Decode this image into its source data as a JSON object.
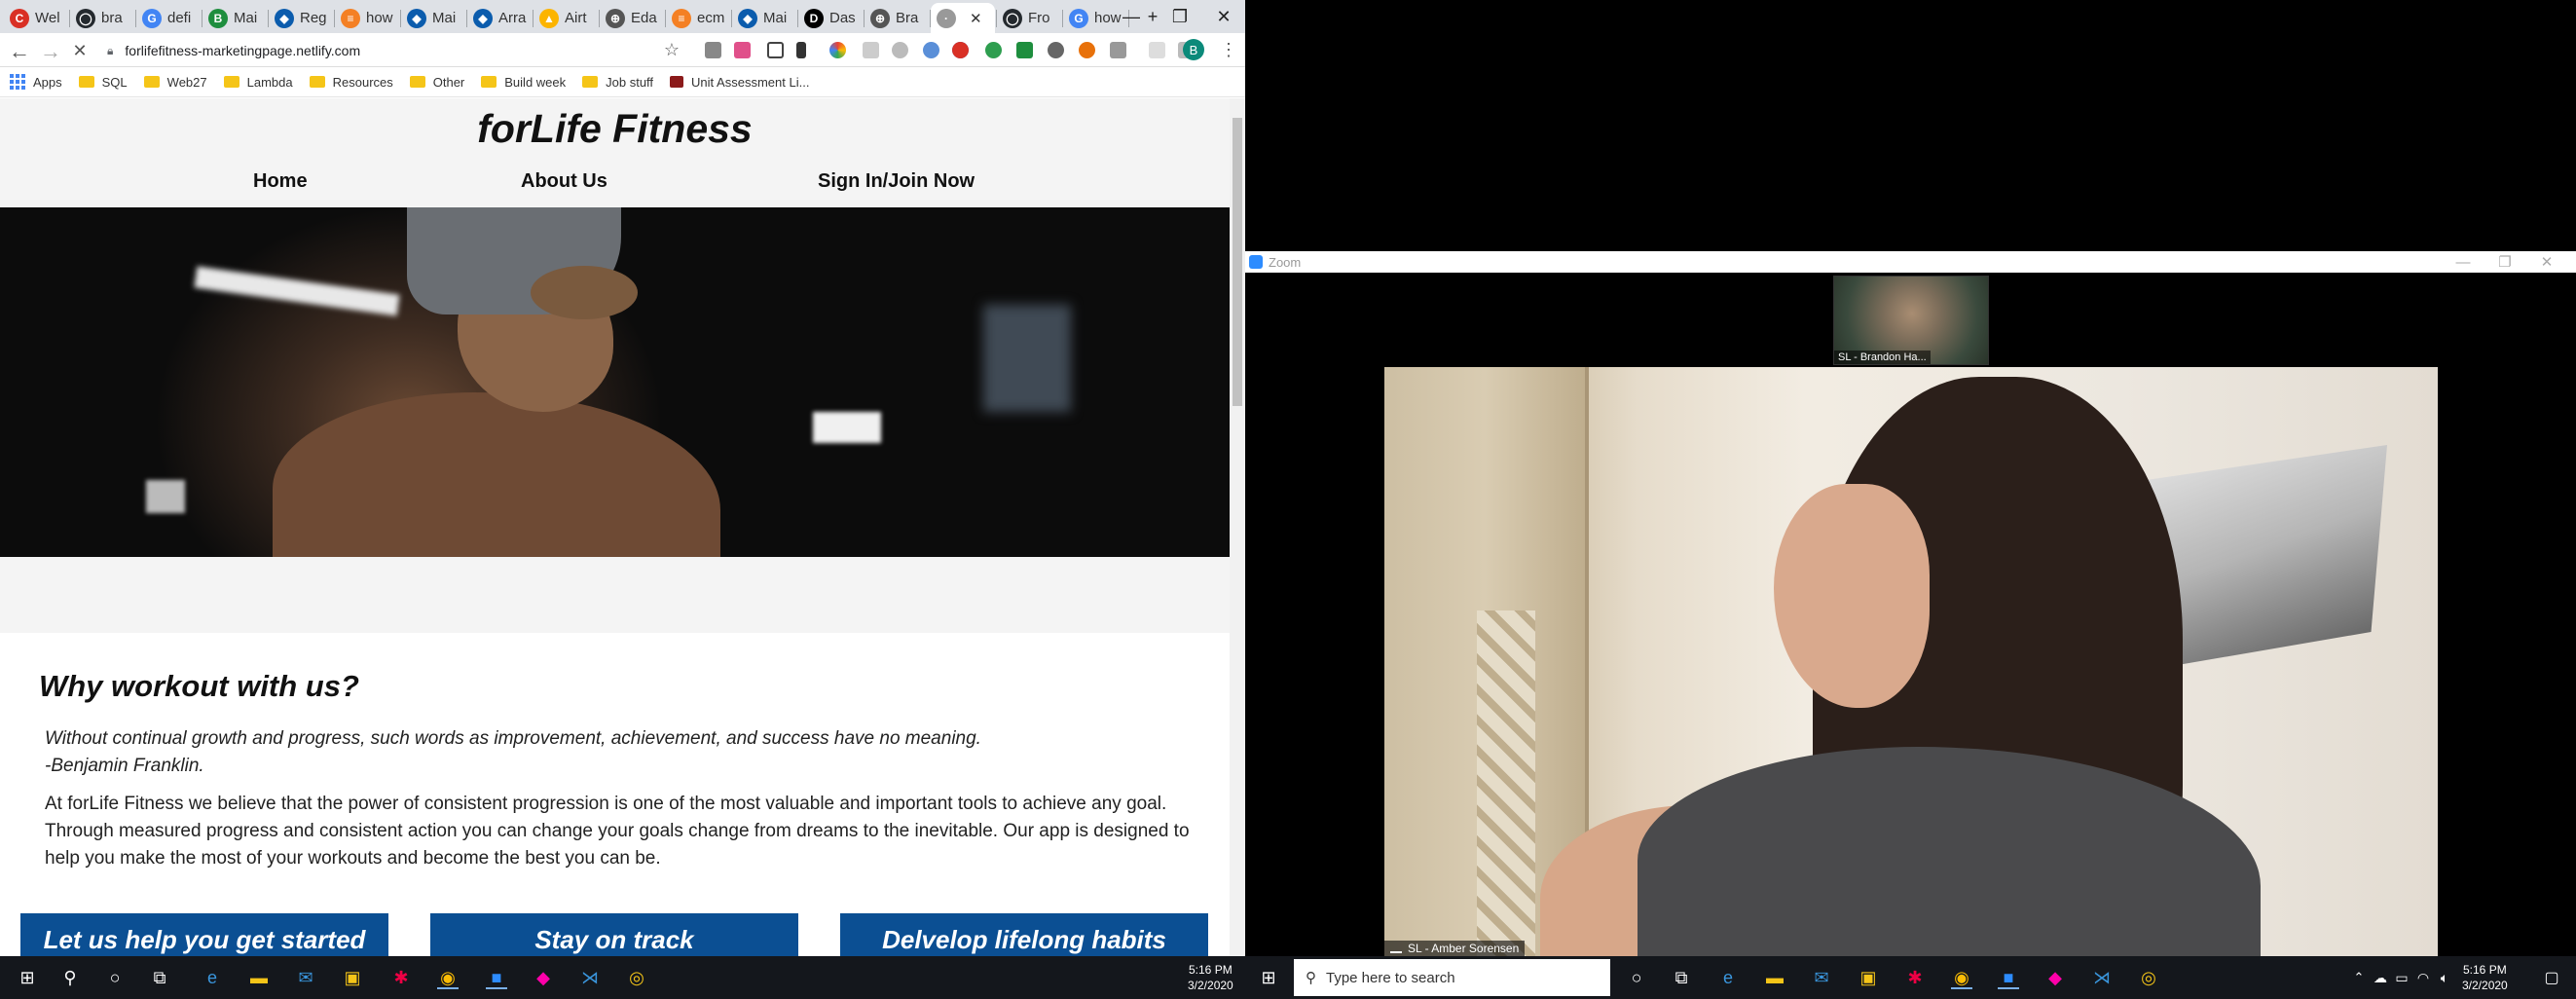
{
  "browser": {
    "tabs": [
      {
        "label": "Wel",
        "color": "#d93025",
        "glyph": "C"
      },
      {
        "label": "bra",
        "color": "#24292e",
        "glyph": "◯"
      },
      {
        "label": "defi",
        "color": "#4285f4",
        "glyph": "G"
      },
      {
        "label": "Mai",
        "color": "#1e8e3e",
        "glyph": "B"
      },
      {
        "label": "Reg",
        "color": "#0b5cad",
        "glyph": "◆"
      },
      {
        "label": "how",
        "color": "#f48024",
        "glyph": "≡"
      },
      {
        "label": "Mai",
        "color": "#0b5cad",
        "glyph": "◆"
      },
      {
        "label": "Arra",
        "color": "#0b5cad",
        "glyph": "◆"
      },
      {
        "label": "Airt",
        "color": "#fcb400",
        "glyph": "▲"
      },
      {
        "label": "Eda",
        "color": "#555555",
        "glyph": "⊕"
      },
      {
        "label": "ecm",
        "color": "#f48024",
        "glyph": "≡"
      },
      {
        "label": "Mai",
        "color": "#0b5cad",
        "glyph": "◆"
      },
      {
        "label": "Das",
        "color": "#000000",
        "glyph": "D"
      },
      {
        "label": "Bra",
        "color": "#555555",
        "glyph": "⊕"
      },
      {
        "label": "",
        "color": "#999999",
        "glyph": "·",
        "active": true
      },
      {
        "label": "Fro",
        "color": "#24292e",
        "glyph": "◯"
      },
      {
        "label": "how",
        "color": "#4285f4",
        "glyph": "G"
      }
    ],
    "new_tab": "+",
    "window_controls": {
      "minimize": "—",
      "restore": "❐",
      "close": "✕"
    },
    "url": "forlifefitness-marketingpage.netlify.com",
    "profile_initial": "B",
    "bookmarks": [
      {
        "label": "Apps",
        "icon": "apps-icon"
      },
      {
        "label": "SQL",
        "icon": "folder-icon"
      },
      {
        "label": "Web27",
        "icon": "folder-icon"
      },
      {
        "label": "Lambda",
        "icon": "folder-icon"
      },
      {
        "label": "Resources",
        "icon": "folder-icon"
      },
      {
        "label": "Other",
        "icon": "folder-icon"
      },
      {
        "label": "Build week",
        "icon": "folder-icon"
      },
      {
        "label": "Job stuff",
        "icon": "folder-icon"
      },
      {
        "label": "Unit Assessment Li...",
        "icon": "page-icon"
      }
    ]
  },
  "site": {
    "title": "forLife Fitness",
    "nav": [
      "Home",
      "About Us",
      "Sign In/Join Now"
    ],
    "heading": "Why workout with us?",
    "quote_line1": "Without continual growth and progress, such words as improvement, achievement, and success have no meaning.",
    "quote_line2": "-Benjamin Franklin.",
    "body": "At forLife Fitness we believe that the power of consistent progression is one of the most valuable and important tools to achieve any goal. Through measured progress and consistent action you can change your goals change from dreams to the inevitable. Our app is designed to help you make the most of your workouts and become the best you can be.",
    "cards": [
      "Let us help you get started",
      "Stay on track",
      "Delvelop lifelong habits"
    ]
  },
  "zoom": {
    "title": "Zoom",
    "thumbnail_name": "SL - Brandon Ha...",
    "main_name": "SL - Amber Sorensen"
  },
  "taskbar_left": {
    "time": "5:16 PM",
    "date": "3/2/2020"
  },
  "taskbar_right": {
    "search_placeholder": "Type here to search",
    "time": "5:16 PM",
    "date": "3/2/2020"
  }
}
